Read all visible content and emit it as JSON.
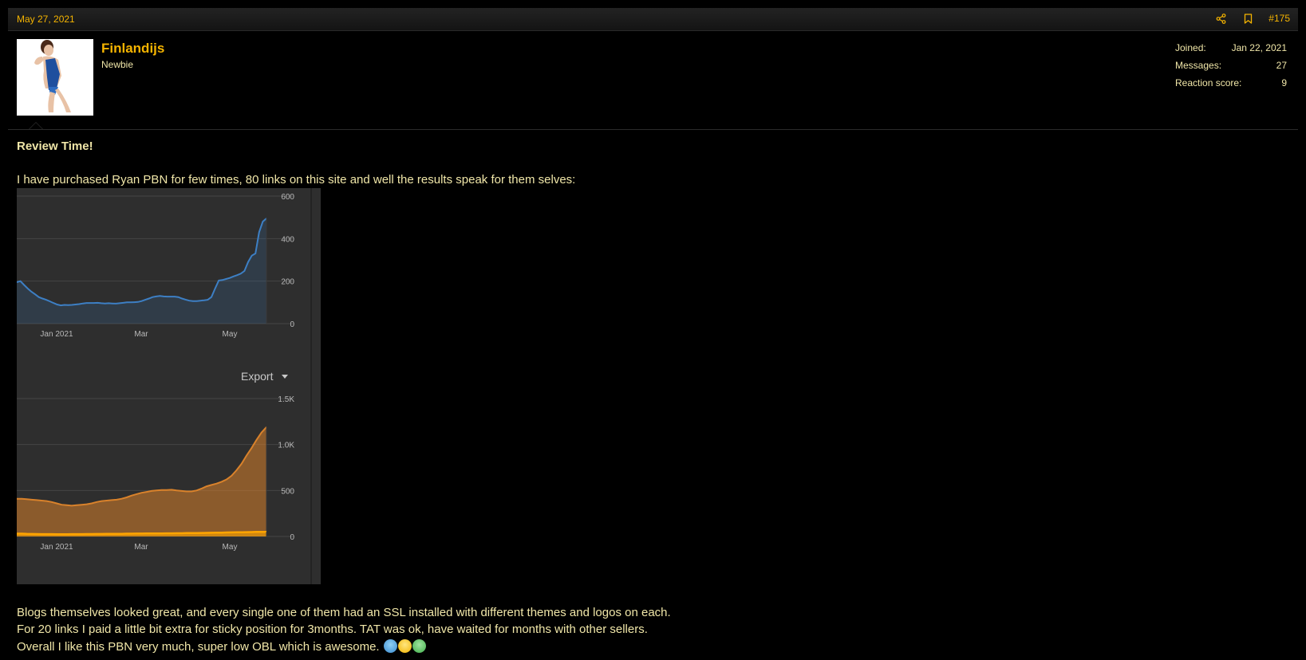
{
  "post": {
    "date": "May 27, 2021",
    "number": "#175",
    "share_icon": "share-icon",
    "bookmark_icon": "bookmark-icon"
  },
  "user": {
    "name": "Finlandijs",
    "title": "Newbie",
    "stats": [
      {
        "label": "Joined:",
        "value": "Jan 22, 2021"
      },
      {
        "label": "Messages:",
        "value": "27"
      },
      {
        "label": "Reaction score:",
        "value": "9"
      }
    ]
  },
  "content": {
    "heading": "Review Time!",
    "intro": "I have purchased Ryan PBN for few times, 80 links on this site and well the results speak for them selves:",
    "lines": [
      "Blogs themselves looked great, and every single one of them had an SSL installed with different themes and logos on each.",
      "For 20 links I paid a little bit extra for sticky position for 3months. TAT was ok, have waited for months with other sellers.",
      "Overall I like this PBN very much, super low OBL which is awesome."
    ],
    "emojis": [
      "nerd-face-emoji",
      "grimace-face-emoji",
      "money-mouth-emoji"
    ]
  },
  "chart_export_label": "Export",
  "colors": {
    "accent": "#f5b400",
    "text": "#f0e6a8",
    "chart_bg": "#2e2e2e",
    "line_blue": "#3d7fc4",
    "area_orange": "#d9822b"
  },
  "chart_data": [
    {
      "type": "line",
      "x_ticks": [
        "Jan 2021",
        "Mar",
        "May"
      ],
      "y_ticks": [
        "600",
        "400",
        "200",
        "0"
      ],
      "ylim": [
        0,
        600
      ],
      "grid": true,
      "series": [
        {
          "values": [
            195,
            200,
            182,
            165,
            150,
            138,
            125,
            118,
            112,
            105,
            97,
            90,
            86,
            88,
            87,
            88,
            90,
            92,
            95,
            97,
            97,
            97,
            98,
            96,
            95,
            96,
            95,
            94,
            96,
            98,
            100,
            100,
            101,
            102,
            106,
            112,
            118,
            125,
            128,
            130,
            128,
            127,
            127,
            127,
            125,
            118,
            113,
            108,
            106,
            106,
            108,
            110,
            112,
            125,
            165,
            203,
            205,
            210,
            215,
            222,
            228,
            235,
            248,
            290,
            320,
            330,
            430,
            480,
            495
          ]
        }
      ]
    },
    {
      "type": "area",
      "x_ticks": [
        "Jan 2021",
        "Mar",
        "May"
      ],
      "y_ticks": [
        "1.5K",
        "1.0K",
        "500",
        "0"
      ],
      "ylim": [
        0,
        1500
      ],
      "grid": true,
      "series": [
        {
          "values": [
            410,
            410,
            405,
            400,
            395,
            390,
            385,
            375,
            360,
            345,
            340,
            335,
            340,
            345,
            350,
            360,
            375,
            385,
            390,
            395,
            400,
            410,
            425,
            445,
            460,
            475,
            485,
            495,
            500,
            505,
            505,
            508,
            500,
            495,
            490,
            490,
            500,
            520,
            545,
            560,
            575,
            595,
            620,
            660,
            720,
            790,
            880,
            960,
            1050,
            1130,
            1190
          ]
        },
        {
          "values": [
            30,
            30,
            28,
            27,
            26,
            25,
            25,
            25,
            24,
            24,
            24,
            25,
            25,
            25,
            26,
            26,
            27,
            27,
            28,
            28,
            29,
            29,
            30,
            30,
            31,
            31,
            32,
            32,
            33,
            33,
            34,
            34,
            35,
            35,
            36,
            36,
            37,
            38,
            39,
            40,
            41,
            42,
            43,
            44,
            45,
            46,
            47,
            48,
            49,
            50,
            50
          ]
        }
      ]
    }
  ]
}
